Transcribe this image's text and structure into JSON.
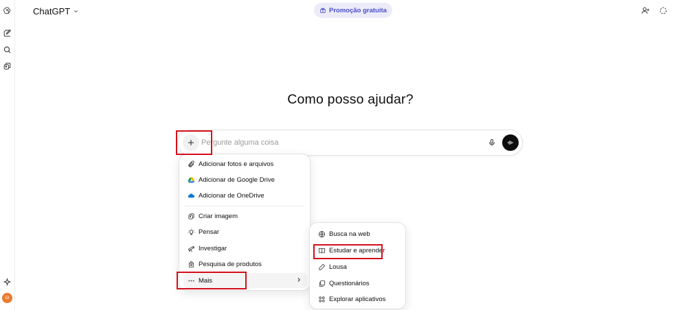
{
  "app": {
    "model_name": "ChatGPT",
    "promo_label": "Promoção gratuita"
  },
  "main": {
    "heading": "Como posso ajudar?"
  },
  "composer": {
    "placeholder": "Pergunte alguma coisa"
  },
  "sidebar": {
    "avatar_initials": "GI",
    "icons": [
      "chatgpt-logo-icon",
      "new-chat-icon",
      "search-icon",
      "library-icon",
      "sparkle-icon"
    ]
  },
  "attach_menu": {
    "items": [
      {
        "label": "Adicionar fotos e arquivos",
        "icon": "paperclip-icon"
      },
      {
        "label": "Adicionar de Google Drive",
        "icon": "google-drive-icon"
      },
      {
        "label": "Adicionar de OneDrive",
        "icon": "onedrive-icon"
      },
      {
        "label": "Criar imagem",
        "icon": "image-create-icon"
      },
      {
        "label": "Pensar",
        "icon": "lightbulb-icon"
      },
      {
        "label": "Investigar",
        "icon": "telescope-icon"
      },
      {
        "label": "Pesquisa de produtos",
        "icon": "shopping-bag-icon"
      },
      {
        "label": "Mais",
        "icon": "more-dots-icon"
      }
    ]
  },
  "more_menu": {
    "items": [
      {
        "label": "Busca na web",
        "icon": "globe-icon"
      },
      {
        "label": "Estudar e aprender",
        "icon": "book-icon"
      },
      {
        "label": "Lousa",
        "icon": "pen-icon"
      },
      {
        "label": "Questionários",
        "icon": "quiz-cards-icon"
      },
      {
        "label": "Explorar aplicativos",
        "icon": "apps-grid-icon"
      }
    ]
  },
  "colors": {
    "highlight": "#d40f19",
    "promo_bg": "#ececf9",
    "promo_text": "#4b4bc9",
    "avatar": "#ea7b2c"
  }
}
